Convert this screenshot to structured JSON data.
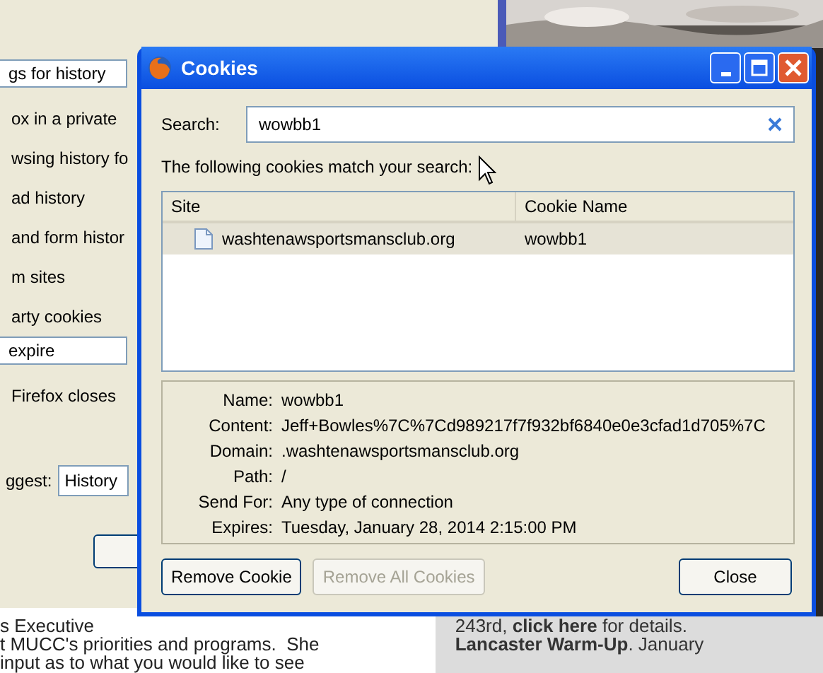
{
  "background_window": {
    "items": [
      {
        "kind": "dropdown",
        "text": "gs for history"
      },
      {
        "kind": "label",
        "text": "ox in a private"
      },
      {
        "kind": "label",
        "text": "wsing history fo"
      },
      {
        "kind": "label",
        "text": "ad history"
      },
      {
        "kind": "label",
        "text": "and form histor"
      },
      {
        "kind": "label",
        "text": "m sites"
      },
      {
        "kind": "label",
        "text": "arty cookies"
      },
      {
        "kind": "dropdown",
        "text": "expire"
      },
      {
        "kind": "label",
        "text": "Firefox closes"
      },
      {
        "kind": "labeled_dropdown",
        "label": "ggest:",
        "text": "History"
      },
      {
        "kind": "button"
      }
    ]
  },
  "web_page": {
    "left_lines": [
      "s Executive",
      "t MUCC's priorities and programs.  She",
      "input as to what you would like to see"
    ],
    "right_lines": [
      "243rd, **click here** for details.",
      "**Lancaster Warm-Up**. January"
    ]
  },
  "cookies_dialog": {
    "title": "Cookies",
    "search": {
      "label": "Search:",
      "value": "wowbb1"
    },
    "match_text": "The following cookies match your search:",
    "table": {
      "columns": [
        "Site",
        "Cookie Name"
      ],
      "rows": [
        {
          "site": "washtenawsportsmansclub.org",
          "cookie_name": "wowbb1",
          "selected": true
        }
      ]
    },
    "details": [
      {
        "label": "Name:",
        "value": "wowbb1"
      },
      {
        "label": "Content:",
        "value": "Jeff+Bowles%7C%7Cd989217f7f932bf6840e0e3cfad1d705%7C"
      },
      {
        "label": "Domain:",
        "value": ".washtenawsportsmansclub.org"
      },
      {
        "label": "Path:",
        "value": "/"
      },
      {
        "label": "Send For:",
        "value": "Any type of connection"
      },
      {
        "label": "Expires:",
        "value": "Tuesday, January 28, 2014 2:15:00 PM"
      }
    ],
    "buttons": [
      {
        "label": "Remove Cookie",
        "disabled": false,
        "kind": "left"
      },
      {
        "label": "Remove All Cookies",
        "disabled": true,
        "kind": "left"
      },
      {
        "label": "Close",
        "disabled": false,
        "kind": "right"
      }
    ]
  }
}
